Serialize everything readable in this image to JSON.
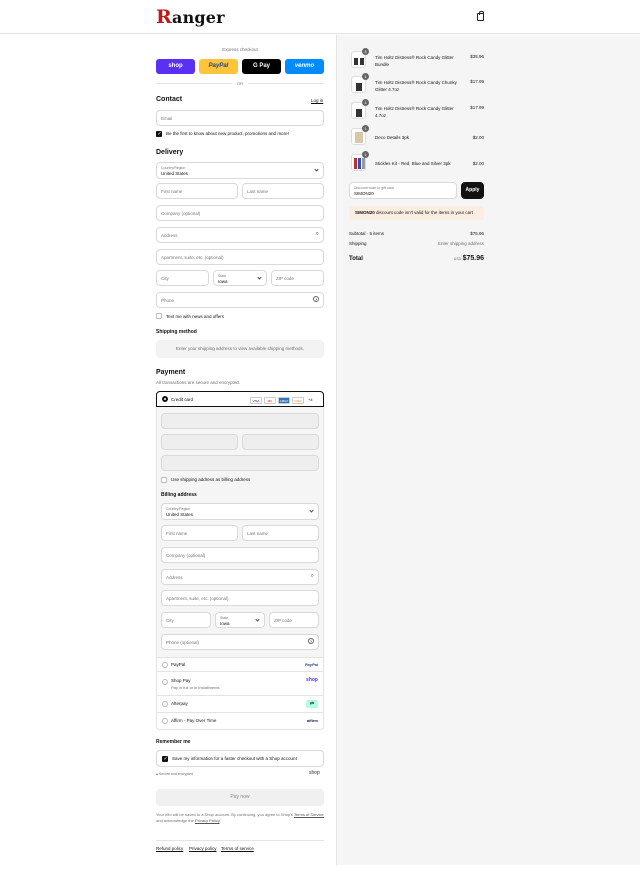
{
  "header": {
    "logo_initial": "R",
    "logo_rest": "anger",
    "cart_icon": "shopping-bag-icon"
  },
  "express": {
    "title": "Express checkout",
    "buttons": [
      {
        "label": "shop",
        "color": "#5a31f4",
        "text_color": "#ffffff"
      },
      {
        "label": "PayPal",
        "color": "#ffc439",
        "text_color": "#1d3f92"
      },
      {
        "label": "G Pay",
        "color": "#000000",
        "text_color": "#ffffff"
      },
      {
        "label": "venmo",
        "color": "#008cff",
        "text_color": "#ffffff"
      }
    ],
    "or": "OR"
  },
  "contact": {
    "title": "Contact",
    "login": "Log in",
    "email_placeholder": "Email",
    "newsletter": "Be the first to know about new product, promotions and more!"
  },
  "delivery": {
    "title": "Delivery",
    "country_label": "Country/Region",
    "country": "United States",
    "first_name": "First name",
    "last_name": "Last name",
    "company": "Company (optional)",
    "address": "Address",
    "apartment": "Apartment, suite, etc. (optional)",
    "city": "City",
    "state_label": "State",
    "state": "Iowa",
    "zip": "ZIP code",
    "phone": "Phone",
    "text_me": "Text me with news and offers"
  },
  "shipping_method": {
    "title": "Shipping method",
    "notice": "Enter your shipping address to view available shipping methods."
  },
  "payment": {
    "title": "Payment",
    "subtitle": "All transactions are secure and encrypted.",
    "credit_card": "Credit card",
    "card_brands": [
      "VISA",
      "MC",
      "AMEX",
      "DISC",
      "+4"
    ],
    "use_shipping": "Use shipping address as billing address",
    "billing_title": "Billing address",
    "billing": {
      "country_label": "Country/Region",
      "country": "United States",
      "first_name": "First name",
      "last_name": "Last name",
      "company": "Company (optional)",
      "address": "Address",
      "apartment": "Apartment, suite, etc. (optional)",
      "city": "City",
      "state_label": "State",
      "state": "Iowa",
      "zip": "ZIP code",
      "phone": "Phone (optional)"
    },
    "methods": [
      {
        "label": "PayPal",
        "sub": "",
        "badge": "PayPal"
      },
      {
        "label": "Shop Pay",
        "sub": "Pay in full or in installments",
        "badge": "shop"
      },
      {
        "label": "Afterpay",
        "sub": "",
        "badge": "⇄"
      },
      {
        "label": "Affirm - Pay Over Time",
        "sub": "",
        "badge": "affirm"
      }
    ]
  },
  "remember": {
    "title": "Remember me",
    "save_info": "Save my information for a faster checkout with a Shop account",
    "secure": "Secure and encrypted",
    "shop_logo": "shop"
  },
  "pay_now": "Pay now",
  "terms": {
    "line1": "Your info will be saved to a Shop account. By continuing, you agree to Shop's",
    "tos": "Terms of Service",
    "and": "and acknowledge the",
    "privacy": "Privacy Policy",
    "period": "."
  },
  "footer_links": [
    "Refund policy",
    "Privacy policy",
    "Terms of service"
  ],
  "order": {
    "items": [
      {
        "name": "Tim Holtz Distress® Rock Candy Glitter Bundle",
        "price": "$35.96",
        "qty": "4"
      },
      {
        "name": "Tim Holtz Distress® Rock Candy Chunky Glitter 4.7oz",
        "price": "$17.99",
        "qty": "1"
      },
      {
        "name": "Tim Holtz Distress® Rock Candy Glitter 4.7oz",
        "price": "$17.99",
        "qty": "1"
      },
      {
        "name": "Deco Details 3pk",
        "price": "$2.00",
        "qty": "1"
      },
      {
        "name": "Stickles Kit - Red, Blue and Silver 3pk",
        "price": "$2.00",
        "qty": "1"
      }
    ],
    "discount_label": "Discount code or gift card",
    "discount_value": "SIMON20",
    "apply": "Apply",
    "discount_code": "SIMON20",
    "discount_error": "discount code isn't valid for the items in your cart",
    "subtotal_label": "Subtotal · 5 items",
    "subtotal": "$75.96",
    "shipping_label": "Shipping",
    "shipping_value": "Enter shipping address",
    "total_label": "Total",
    "currency": "USD",
    "total": "$75.96"
  }
}
